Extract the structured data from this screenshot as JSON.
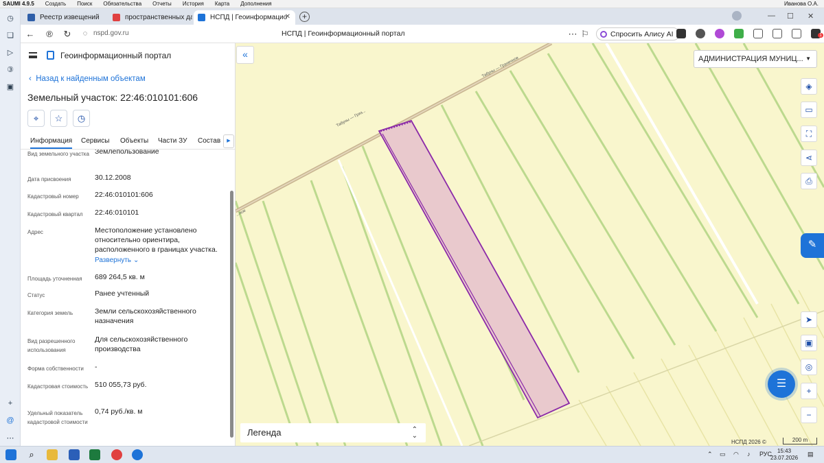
{
  "os_menu": {
    "app": "SAUMI 4.9.5",
    "items": [
      "Создать",
      "Поиск",
      "Обязательства",
      "Отчеты",
      "История",
      "Карта",
      "Дополнения"
    ],
    "user": "Иванова О.А."
  },
  "browser": {
    "tabs": [
      {
        "label": "Реестр извещений"
      },
      {
        "label": "пространственных данн"
      },
      {
        "label": "НСПД | Геоинформацио"
      }
    ],
    "url": "nspd.gov.ru",
    "page_title": "НСПД | Геоинформационный портал",
    "alisa_label": "Спросить Алису AI",
    "badge_count": "1"
  },
  "panel": {
    "portal_name": "Геоинформационный портал",
    "back_link": "Назад к найденным объектам",
    "title": "Земельный участок: 22:46:010101:606",
    "tabs": [
      "Информация",
      "Сервисы",
      "Объекты",
      "Части ЗУ",
      "Состав"
    ],
    "fields": [
      {
        "label": "Вид земельного участка",
        "value": "Землепользование"
      },
      {
        "label": "Дата присвоения",
        "value": "30.12.2008"
      },
      {
        "label": "Кадастровый номер",
        "value": "22:46:010101:606"
      },
      {
        "label": "Кадастровый квартал",
        "value": "22:46:010101"
      },
      {
        "label": "Адрес",
        "value": "Местоположение установлено относительно ориентира, расположенного в границах участка.",
        "link": "Развернуть"
      },
      {
        "label": "Площадь уточненная",
        "value": "689 264,5 кв. м"
      },
      {
        "label": "Статус",
        "value": "Ранее учтенный"
      },
      {
        "label": "Категория земель",
        "value": "Земли сельскохозяйственного назначения"
      },
      {
        "label": "Вид разрешенного использования",
        "value": "Для сельскохозяйственного производства"
      },
      {
        "label": "Форма собственности",
        "value": "-"
      },
      {
        "label": "Кадастровая стоимость",
        "value": "510 055,73 руб."
      },
      {
        "label": "Удельный показатель кадастровой стоимости",
        "value": "0,74 руб./кв. м"
      }
    ]
  },
  "map": {
    "region_select": "АДМИНИСТРАЦИЯ МУНИЦ...",
    "road_label_1": "Табуны — Гряз...",
    "road_label_2": "Табуны — Граничное",
    "road_label_3": "...ное",
    "legend_label": "Легенда",
    "copyright": "НСПД 2026 ©",
    "scale": "200 m",
    "colors": {
      "background": "#f9f6cd",
      "parcel_fill": "#e9c9cd",
      "parcel_stroke": "#8b2aa8",
      "fields": "#b8d88a",
      "road": "#c8b490"
    }
  },
  "taskbar": {
    "lang": "РУС",
    "time": "15:43",
    "date": "23.07.2026"
  }
}
